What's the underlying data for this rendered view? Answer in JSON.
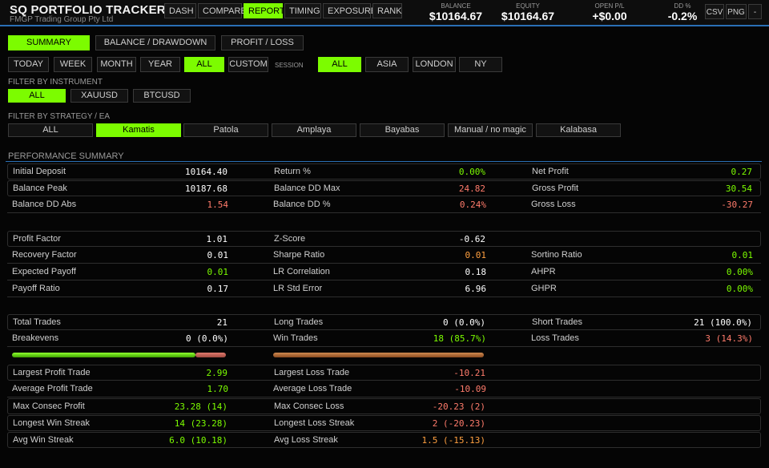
{
  "header": {
    "title": "SQ  PORTFOLIO TRACKER",
    "subtitle": "FMGP Trading Group Pty Ltd",
    "nav": [
      {
        "label": "DASH",
        "active": false
      },
      {
        "label": "COMPARE",
        "active": false
      },
      {
        "label": "REPORT",
        "active": true
      },
      {
        "label": "TIMING",
        "active": false
      },
      {
        "label": "EXPOSURE",
        "active": false
      },
      {
        "label": "RANK",
        "active": false
      }
    ],
    "stats": {
      "balance": {
        "label": "BALANCE",
        "value": "$10164.67"
      },
      "equity": {
        "label": "EQUITY",
        "value": "$10164.67"
      },
      "open_pl": {
        "label": "OPEN P/L",
        "value": "+$0.00"
      },
      "dd": {
        "label": "DD %",
        "value": "-0.2%"
      }
    },
    "actions": {
      "csv": "CSV",
      "png": "PNG",
      "minimize": "-"
    }
  },
  "report_tabs": [
    {
      "label": "SUMMARY",
      "active": true
    },
    {
      "label": "BALANCE / DRAWDOWN",
      "active": false
    },
    {
      "label": "PROFIT / LOSS",
      "active": false
    }
  ],
  "period": [
    {
      "label": "TODAY",
      "active": false
    },
    {
      "label": "WEEK",
      "active": false
    },
    {
      "label": "MONTH",
      "active": false
    },
    {
      "label": "YEAR",
      "active": false
    },
    {
      "label": "ALL",
      "active": true
    },
    {
      "label": "CUSTOM",
      "active": false
    }
  ],
  "session": {
    "label": "SESSION",
    "options": [
      {
        "label": "ALL",
        "active": true
      },
      {
        "label": "ASIA",
        "active": false
      },
      {
        "label": "LONDON",
        "active": false
      },
      {
        "label": "NY",
        "active": false
      }
    ]
  },
  "instrument_filter": {
    "label": "FILTER BY INSTRUMENT",
    "options": [
      {
        "label": "ALL",
        "active": true
      },
      {
        "label": "XAUUSD",
        "active": false
      },
      {
        "label": "BTCUSD",
        "active": false
      }
    ]
  },
  "strategy_filter": {
    "label": "FILTER BY STRATEGY / EA",
    "options": [
      {
        "label": "ALL",
        "active": false
      },
      {
        "label": "Kamatis",
        "active": true
      },
      {
        "label": "Patola",
        "active": false
      },
      {
        "label": "Amplaya",
        "active": false
      },
      {
        "label": "Bayabas",
        "active": false
      },
      {
        "label": "Manual / no magic",
        "active": false
      },
      {
        "label": "Kalabasa",
        "active": false
      }
    ]
  },
  "summary": {
    "section_title": "PERFORMANCE SUMMARY",
    "rows": [
      {
        "c1": [
          "Initial Deposit",
          "10164.40"
        ],
        "c2": [
          "Return %",
          "0.00%"
        ],
        "c3": [
          "Net Profit",
          "0.27"
        ]
      },
      {
        "c1": [
          "Balance Peak",
          "10187.68"
        ],
        "c2": [
          "Balance DD Max",
          "24.82"
        ],
        "c3": [
          "Gross Profit",
          "30.54"
        ]
      },
      {
        "c1": [
          "Balance DD Abs",
          "1.54"
        ],
        "c2": [
          "Balance DD %",
          "0.24%"
        ],
        "c3": [
          "Gross Loss",
          "-30.27"
        ]
      },
      {
        "c1": [
          "Profit Factor",
          "1.01"
        ],
        "c2": [
          "Z-Score",
          "-0.62"
        ],
        "c3": [
          "",
          ""
        ]
      },
      {
        "c1": [
          "Recovery Factor",
          "0.01"
        ],
        "c2": [
          "Sharpe Ratio",
          "0.01"
        ],
        "c3": [
          "Sortino Ratio",
          "0.01"
        ]
      },
      {
        "c1": [
          "Expected Payoff",
          "0.01"
        ],
        "c2": [
          "LR Correlation",
          "0.18"
        ],
        "c3": [
          "AHPR",
          "0.00%"
        ]
      },
      {
        "c1": [
          "Payoff Ratio",
          "0.17"
        ],
        "c2": [
          "LR Std Error",
          "6.96"
        ],
        "c3": [
          "GHPR",
          "0.00%"
        ]
      },
      {
        "c1": [
          "Total Trades",
          "21"
        ],
        "c2": [
          "Long Trades",
          "0 (0.0%)"
        ],
        "c3": [
          "Short Trades",
          "21 (100.0%)"
        ]
      },
      {
        "c1": [
          "Breakevens",
          "0 (0.0%)"
        ],
        "c2": [
          "Win Trades",
          "18 (85.7%)"
        ],
        "c3": [
          "Loss Trades",
          "3 (14.3%)"
        ]
      },
      {
        "c1": [
          "Largest Profit Trade",
          "2.99"
        ],
        "c2": [
          "Largest Loss Trade",
          "-10.21"
        ],
        "c3": [
          "",
          ""
        ]
      },
      {
        "c1": [
          "Average Profit Trade",
          "1.70"
        ],
        "c2": [
          "Average Loss Trade",
          "-10.09"
        ],
        "c3": [
          "",
          ""
        ]
      },
      {
        "c1": [
          "Max Consec Profit",
          "23.28 (14)"
        ],
        "c2": [
          "Max Consec Loss",
          "-20.23 (2)"
        ],
        "c3": [
          "",
          ""
        ]
      },
      {
        "c1": [
          "Longest Win Streak",
          "14 (23.28)"
        ],
        "c2": [
          "Longest Loss Streak",
          "2 (-20.23)"
        ],
        "c3": [
          "",
          ""
        ]
      },
      {
        "c1": [
          "Avg Win Streak",
          "6.0 (10.18)"
        ],
        "c2": [
          "Avg Loss Streak",
          "1.5 (-15.13)"
        ],
        "c3": [
          "",
          ""
        ]
      }
    ],
    "win_loss_split": {
      "win_fraction": 0.857,
      "loss_fraction": 0.143
    },
    "long_short_split": {
      "long_fraction": 0.0,
      "short_fraction": 1.0
    }
  },
  "colors": {
    "accent": "#7cfc00",
    "header_line": "#2a6fb5",
    "positive": "#7cfc00",
    "negative": "#ff7b6b",
    "neutral": "#ffa040"
  }
}
